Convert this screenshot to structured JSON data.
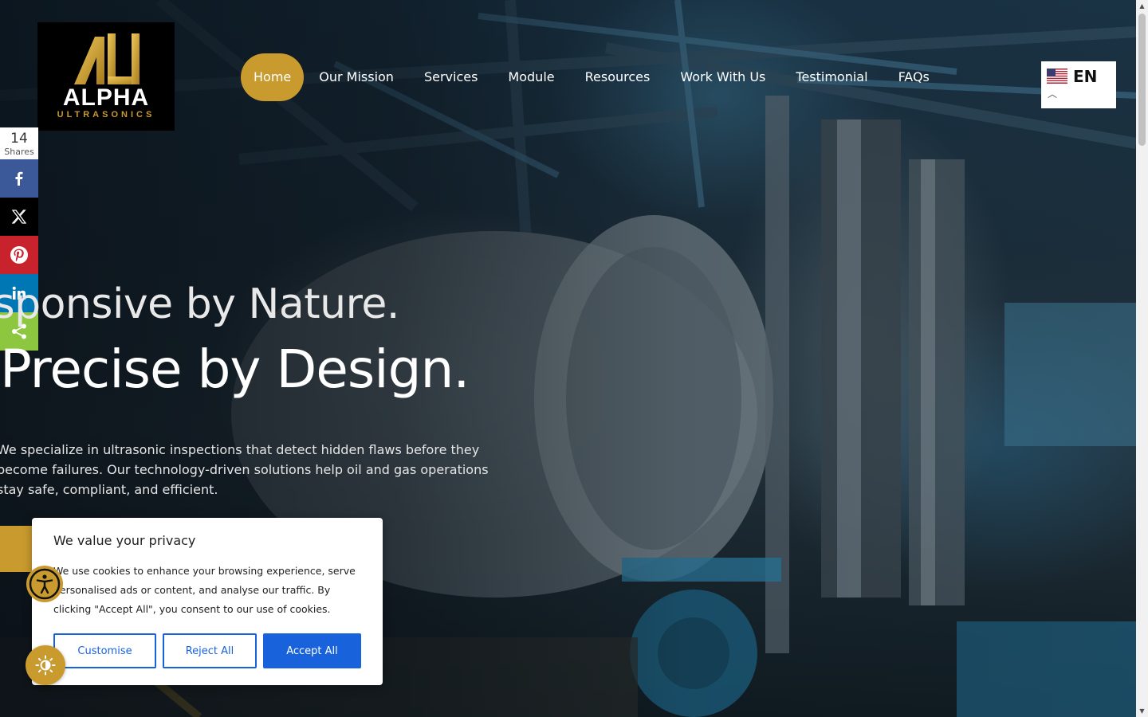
{
  "brand": {
    "name": "ALPHA",
    "tagline": "ULTRASONICS",
    "gold": "#c99a2e"
  },
  "nav": {
    "items": [
      {
        "label": "Home",
        "active": true
      },
      {
        "label": "Our Mission"
      },
      {
        "label": "Services"
      },
      {
        "label": "Module"
      },
      {
        "label": "Resources"
      },
      {
        "label": "Work With Us"
      },
      {
        "label": "Testimonial"
      },
      {
        "label": "FAQs"
      }
    ]
  },
  "language": {
    "code": "EN",
    "flag_icon": "us-flag-icon",
    "caret_icon": "chevron-up-icon"
  },
  "share": {
    "count": "14",
    "label": "Shares",
    "buttons": [
      {
        "network": "facebook",
        "icon": "facebook-icon",
        "color": "#3b5998"
      },
      {
        "network": "x",
        "icon": "x-icon",
        "color": "#000000"
      },
      {
        "network": "pinterest",
        "icon": "pinterest-icon",
        "color": "#c8232c"
      },
      {
        "network": "linkedin",
        "icon": "linkedin-icon",
        "color": "#0077b5"
      },
      {
        "network": "share",
        "icon": "share-icon",
        "color": "#8dc63f"
      }
    ]
  },
  "hero": {
    "headline1": "esponsive by Nature.",
    "headline2": "Precise by Design.",
    "description": "We specialize in ultrasonic inspections that detect hidden flaws before they become failures. Our technology-driven solutions help oil and gas operations stay safe, compliant, and efficient."
  },
  "cookie": {
    "title": "We value your privacy",
    "text": "We use cookies to enhance your browsing experience, serve personalised ads or content, and analyse our traffic. By clicking \"Accept All\", you consent to our use of cookies.",
    "customise_label": "Customise",
    "reject_label": "Reject All",
    "accept_label": "Accept All",
    "accent": "#1863dc"
  },
  "widgets": {
    "accessibility_icon": "accessibility-icon",
    "theme_icon": "sun-icon"
  }
}
